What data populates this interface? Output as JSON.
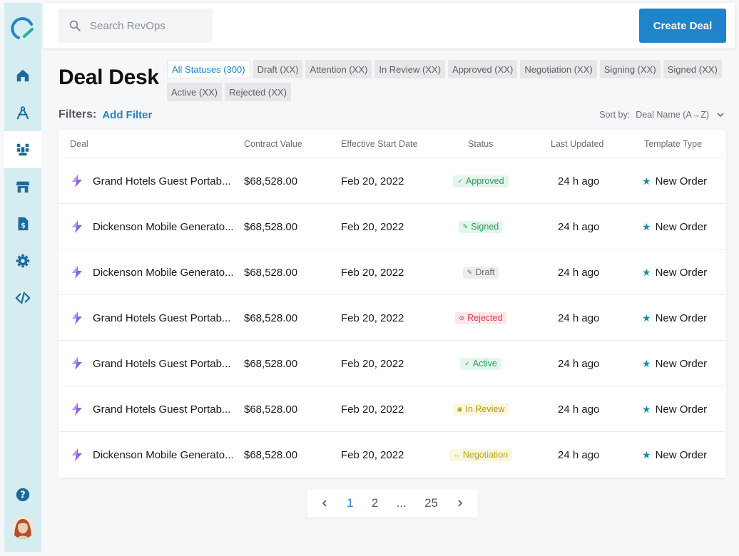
{
  "search": {
    "placeholder": "Search RevOps"
  },
  "header": {
    "create_label": "Create Deal"
  },
  "page": {
    "title": "Deal Desk"
  },
  "status_filters": [
    "All Statuses (300)",
    "Draft (XX)",
    "Attention (XX)",
    "In Review (XX)",
    "Approved (XX)",
    "Negotiation (XX)",
    "Signing (XX)",
    "Signed (XX)",
    "Active (XX)",
    "Rejected (XX)"
  ],
  "filters": {
    "label": "Filters:",
    "add_label": "Add Filter"
  },
  "sort": {
    "label": "Sort by:",
    "value": "Deal Name (A→Z)"
  },
  "table": {
    "columns": [
      "Deal",
      "Contract Value",
      "Effective Start Date",
      "Status",
      "Last Updated",
      "Template Type"
    ],
    "rows": [
      {
        "deal": "Grand Hotels Guest Portab...",
        "value": "$68,528.00",
        "date": "Feb 20, 2022",
        "status": "Approved",
        "status_kind": "approved",
        "updated": "24 h ago",
        "template": "New Order"
      },
      {
        "deal": "Dickenson Mobile Generato...",
        "value": "$68,528.00",
        "date": "Feb 20, 2022",
        "status": "Signed",
        "status_kind": "signed",
        "updated": "24 h ago",
        "template": "New Order"
      },
      {
        "deal": "Dickenson Mobile Generato...",
        "value": "$68,528.00",
        "date": "Feb 20, 2022",
        "status": "Draft",
        "status_kind": "draft",
        "updated": "24 h ago",
        "template": "New Order"
      },
      {
        "deal": "Grand Hotels Guest Portab...",
        "value": "$68,528.00",
        "date": "Feb 20, 2022",
        "status": "Rejected",
        "status_kind": "rejected",
        "updated": "24 h ago",
        "template": "New Order"
      },
      {
        "deal": "Grand Hotels Guest Portab...",
        "value": "$68,528.00",
        "date": "Feb 20, 2022",
        "status": "Active",
        "status_kind": "active",
        "updated": "24 h ago",
        "template": "New Order"
      },
      {
        "deal": "Grand Hotels Guest Portab...",
        "value": "$68,528.00",
        "date": "Feb 20, 2022",
        "status": "In Review",
        "status_kind": "review",
        "updated": "24 h ago",
        "template": "New Order"
      },
      {
        "deal": "Dickenson Mobile Generato...",
        "value": "$68,528.00",
        "date": "Feb 20, 2022",
        "status": "Negotiation",
        "status_kind": "negotiation",
        "updated": "24 h ago",
        "template": "New Order"
      }
    ]
  },
  "pagination": {
    "pages": [
      "1",
      "2",
      "...",
      "25"
    ],
    "current": "1"
  },
  "colors": {
    "accent": "#1f84c9",
    "sidebar": "#d5ecf0",
    "icon": "#1a6a9e",
    "deal_icon": "#8b5cf6",
    "template_icon": "#15909a"
  },
  "sidebar": {
    "items": [
      "home-icon",
      "compass-icon",
      "deals-icon",
      "store-icon",
      "invoice-icon",
      "gear-icon",
      "code-icon"
    ],
    "active": "deals-icon",
    "bottom": [
      "help-icon",
      "avatar"
    ]
  }
}
